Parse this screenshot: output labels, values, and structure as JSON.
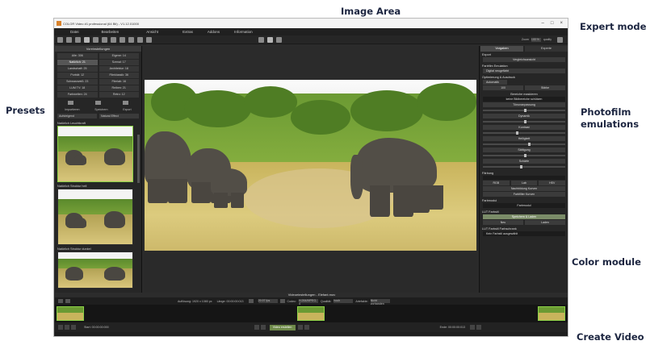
{
  "callouts": {
    "image_area": "Image Area",
    "expert_mode": "Expert mode",
    "presets": "Presets",
    "photofilm": "Photofilm\nemulations",
    "color_module": "Color module",
    "create_video": "Create Video"
  },
  "app": {
    "window_title": "COLOR Video #1 professional (64 Bit) - V1.12.01000",
    "menu": [
      "Datei",
      "Bearbeiten",
      "Ansicht",
      "Extras",
      "Addons",
      "Information"
    ],
    "toolbar": {
      "zoom_label": "Zoom",
      "zoom_value": "100 %",
      "quality_label": "quality"
    }
  },
  "presets_panel": {
    "header": "Voreinstellungen",
    "categories": [
      {
        "label": "Alle: 306",
        "selected": false
      },
      {
        "label": "Eigene: 14",
        "selected": false
      },
      {
        "label": "Natürlich: 21",
        "selected": true
      },
      {
        "label": "Szenal: 17",
        "selected": false
      },
      {
        "label": "Landschaft: 25",
        "selected": false
      },
      {
        "label": "Architektur: 18",
        "selected": false
      },
      {
        "label": "Porträt: 12",
        "selected": false
      },
      {
        "label": "Filmklassik: 36",
        "selected": false
      },
      {
        "label": "Schwarzweiß: 23",
        "selected": false
      },
      {
        "label": "Filmlab: 16",
        "selected": false
      },
      {
        "label": "LUM TV: 18",
        "selected": false
      },
      {
        "label": "Reiben: 21",
        "selected": false
      },
      {
        "label": "Farbwelten: 24",
        "selected": false
      },
      {
        "label": "Retro: 12",
        "selected": false
      }
    ],
    "actions": [
      "Importieren",
      "Speichern",
      "Export"
    ],
    "sort_label": "Aufsteigend",
    "filter_value": "Natural Effect",
    "presets": [
      {
        "name": "Natürlich Leuchtkraft",
        "selected": true
      },
      {
        "name": "Natürlich Struktur hell",
        "selected": false
      },
      {
        "name": "Natürlich Struktur dunkel",
        "selected": false
      }
    ]
  },
  "right_panel": {
    "tabs": [
      {
        "label": "Vorgaben",
        "active": true
      },
      {
        "label": "Experte",
        "active": false
      }
    ],
    "export_label": "Export",
    "compare_button": "Vergleichsansicht",
    "film_emulation_label": "Farbfilm Emulation",
    "film_value": "Digital neugefärbt",
    "optimize_label": "Optimierung & Ausdruck",
    "auto_label": "Automatik",
    "auto_value": "100",
    "auto_btn": "Stärke",
    "range_label": "Bereiche maskieren",
    "range_value": "keine Bildbereiche schützen",
    "tone_button": "Tönunanpassung",
    "sliders": [
      "Dynamik",
      "Kontrast",
      "Helligkeit",
      "Sättigung",
      "Schärfe"
    ],
    "color_label": "Färbung",
    "color_row1": [
      "RGB",
      "Lab",
      "HSV"
    ],
    "color_row2": [
      "Nachbildung Kurven",
      "Farbfilter Kurven"
    ],
    "color_module_label": "Farbmodul",
    "color_module_btn": "Farbmodul",
    "lut_label": "LUT Farbstil",
    "lut_button": "Speichern & Laden",
    "lut_row": [
      "Neu",
      "Laden"
    ],
    "lut_sub_label": "LUT Farbstil Farbschrank",
    "lut_value": "Kein Farbstil ausgewählt"
  },
  "video_panel": {
    "title": "Videoeinstellungen - Elefant.mov",
    "resolution_label": "Auflösung: 1920 x 1080 px",
    "length_label": "Länge: 00:00:00:013",
    "fps_value": "29.97 fps",
    "codec_label": "Codec:",
    "codec_value": "H.264/MPEG-4",
    "quality_label": "Qualität:",
    "quality_value": "hoch",
    "artifact_label": "Artefakte:",
    "artifact_value": "Nicht vorhanden",
    "start_label": "Start: 00:00:00:000",
    "end_label": "Ende: 00:00:00:013",
    "create_button": "Video erstellen"
  }
}
